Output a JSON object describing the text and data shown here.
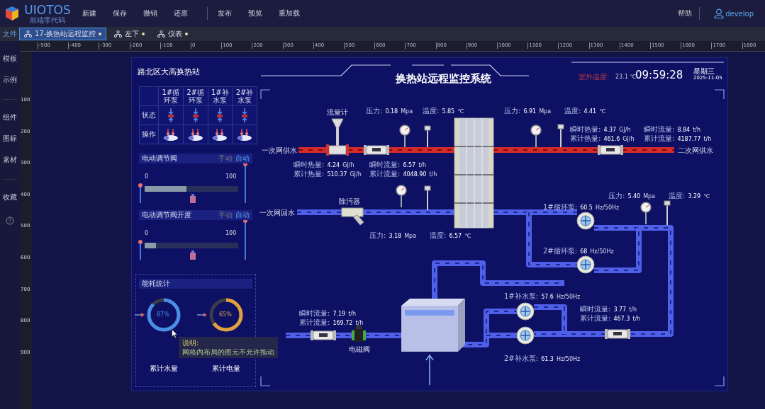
{
  "app": {
    "logo": "UIOTOS",
    "slogan": "前端零代码"
  },
  "menu": [
    [
      "新建",
      "保存",
      "撤销",
      "还原"
    ],
    [
      "发布",
      "预览",
      "重加载"
    ]
  ],
  "help": "帮助",
  "user": "develop",
  "sidebar": {
    "file": "文件",
    "groups": [
      [
        "模板",
        "示例"
      ],
      [
        "组件",
        "图标",
        "素材"
      ],
      [
        "收藏"
      ]
    ]
  },
  "tabs": [
    {
      "label": "17-换热站远程监控",
      "selected": true
    },
    {
      "label": "左下",
      "selected": false
    },
    {
      "label": "仪表",
      "selected": false
    }
  ],
  "ruler": {
    "horizontal": [
      "-500",
      "-400",
      "-300",
      "-200",
      "-100",
      "0",
      "100",
      "200",
      "300",
      "400",
      "500",
      "600",
      "700",
      "800",
      "900",
      "1000",
      "1100",
      "1200",
      "1300",
      "1400",
      "1500",
      "1600",
      "1700",
      "1800"
    ],
    "vertical": [
      "100",
      "200",
      "300",
      "400",
      "500",
      "600",
      "700",
      "800",
      "900"
    ]
  },
  "dashboard": {
    "station": "路北区大高换热站",
    "title": "换热站远程监控系统",
    "outdoor": {
      "label": "室外温度:",
      "value": "23.1 ℃"
    },
    "time": "09:59:28",
    "weekday": "星期三",
    "date": "2025-11-05",
    "pump_table": {
      "columns": [
        "1#循环泵",
        "2#循环泵",
        "1#补水泵",
        "2#补水泵"
      ],
      "rows": [
        "状态",
        "操作"
      ]
    },
    "valves": [
      {
        "title": "电动调节阀",
        "modes": [
          {
            "label": "手动",
            "selected": false
          },
          {
            "label": "自动",
            "selected": true
          }
        ],
        "min": "0",
        "max": "100",
        "level": 0.45
      },
      {
        "title": "电动调节阀开度",
        "modes": [
          {
            "label": "手动",
            "selected": false
          },
          {
            "label": "自动",
            "selected": true
          }
        ],
        "min": "0",
        "max": "100",
        "level": 0.12
      }
    ],
    "energy": {
      "title": "能耗统计",
      "gauges": [
        {
          "value": "87%",
          "level": 0.87,
          "label": "累计水量",
          "color": "#4a8ee8"
        },
        {
          "value": "65%",
          "level": 0.65,
          "label": "累计电量",
          "color": "#e0a040"
        }
      ]
    },
    "tooltip": {
      "title": "说明:",
      "text": "网格内布局的图元不允许拖动"
    },
    "pipe_labels": [
      "一次网供水",
      "二次网供水",
      "一次网回水"
    ],
    "device_labels": [
      "流量计",
      "除污器",
      "电磁阀"
    ],
    "readings": [
      {
        "label": "压力:",
        "value": "0.18",
        "unit": "Mpa"
      },
      {
        "label": "温度:",
        "value": "5.85",
        "unit": "℃"
      },
      {
        "label": "压力:",
        "value": "6.91",
        "unit": "Mpa"
      },
      {
        "label": "温度:",
        "value": "4.41",
        "unit": "℃"
      },
      {
        "label": "瞬时热量:",
        "value": "4.37",
        "unit": "GJ/h"
      },
      {
        "label": "瞬时流量:",
        "value": "8.84",
        "unit": "t/h"
      },
      {
        "label": "累计热量:",
        "value": "461.6",
        "unit": "GJ/h"
      },
      {
        "label": "累计流量:",
        "value": "4187.77",
        "unit": "t/h"
      },
      {
        "label": "瞬时热量:",
        "value": "4.24",
        "unit": "GJ/h"
      },
      {
        "label": "瞬时流量:",
        "value": "6.57",
        "unit": "t/h"
      },
      {
        "label": "累计热量:",
        "value": "510.37",
        "unit": "GJ/h"
      },
      {
        "label": "累计流量:",
        "value": "4048.90",
        "unit": "t/h"
      },
      {
        "label": "压力:",
        "value": "3.18",
        "unit": "Mpa"
      },
      {
        "label": "温度:",
        "value": "6.57",
        "unit": "℃"
      },
      {
        "label": "1#循环泵:",
        "value": "60.5",
        "unit": "Hz/50Hz"
      },
      {
        "label": "2#循环泵:",
        "value": "68",
        "unit": "Hz/50Hz"
      },
      {
        "label": "压力:",
        "value": "5.40",
        "unit": "Mpa"
      },
      {
        "label": "温度:",
        "value": "3.29",
        "unit": "℃"
      },
      {
        "label": "1#补水泵:",
        "value": "57.6",
        "unit": "Hz/50Hz"
      },
      {
        "label": "2#补水泵:",
        "value": "61.3",
        "unit": "Hz/50Hz"
      },
      {
        "label": "瞬时流量:",
        "value": "3.77",
        "unit": "t/h"
      },
      {
        "label": "累计流量:",
        "value": "467.3",
        "unit": "t/h"
      },
      {
        "label": "瞬时流量:",
        "value": "7.19",
        "unit": "t/h"
      },
      {
        "label": "累计流量:",
        "value": "169.72",
        "unit": "t/h"
      }
    ]
  }
}
